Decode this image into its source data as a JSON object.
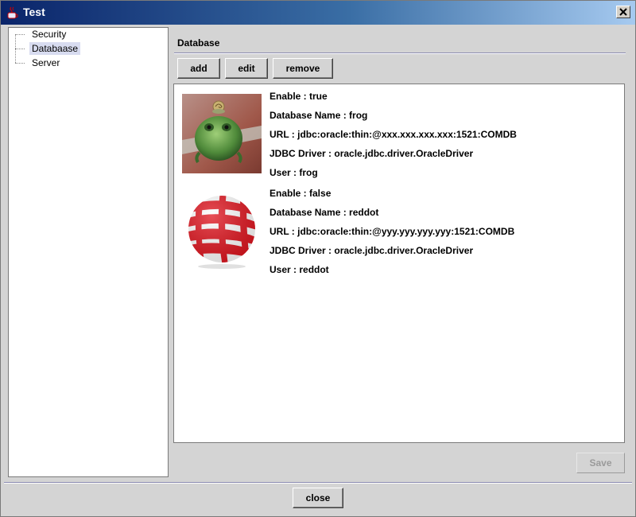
{
  "window": {
    "title": "Test"
  },
  "tree": {
    "items": [
      {
        "label": "Security",
        "selected": false
      },
      {
        "label": "Databaase",
        "selected": true
      },
      {
        "label": "Server",
        "selected": false
      }
    ]
  },
  "section": {
    "title": "Database"
  },
  "toolbar": {
    "add_label": "add",
    "edit_label": "edit",
    "remove_label": "remove"
  },
  "records": [
    {
      "image": "frog-photo",
      "enable": "Enable : true",
      "name": "Database Name : frog",
      "url": "URL : jdbc:oracle:thin:@xxx.xxx.xxx.xxx:1521:COMDB",
      "driver": "JDBC Driver : oracle.jdbc.driver.OracleDriver",
      "user": "User : frog"
    },
    {
      "image": "reddot-ball-logo",
      "enable": "Enable : false",
      "name": "Database Name : reddot",
      "url": "URL : jdbc:oracle:thin:@yyy.yyy.yyy.yyy:1521:COMDB",
      "driver": "JDBC Driver : oracle.jdbc.driver.OracleDriver",
      "user": "User : reddot"
    }
  ],
  "footer": {
    "save_label": "Save",
    "close_label": "close"
  }
}
